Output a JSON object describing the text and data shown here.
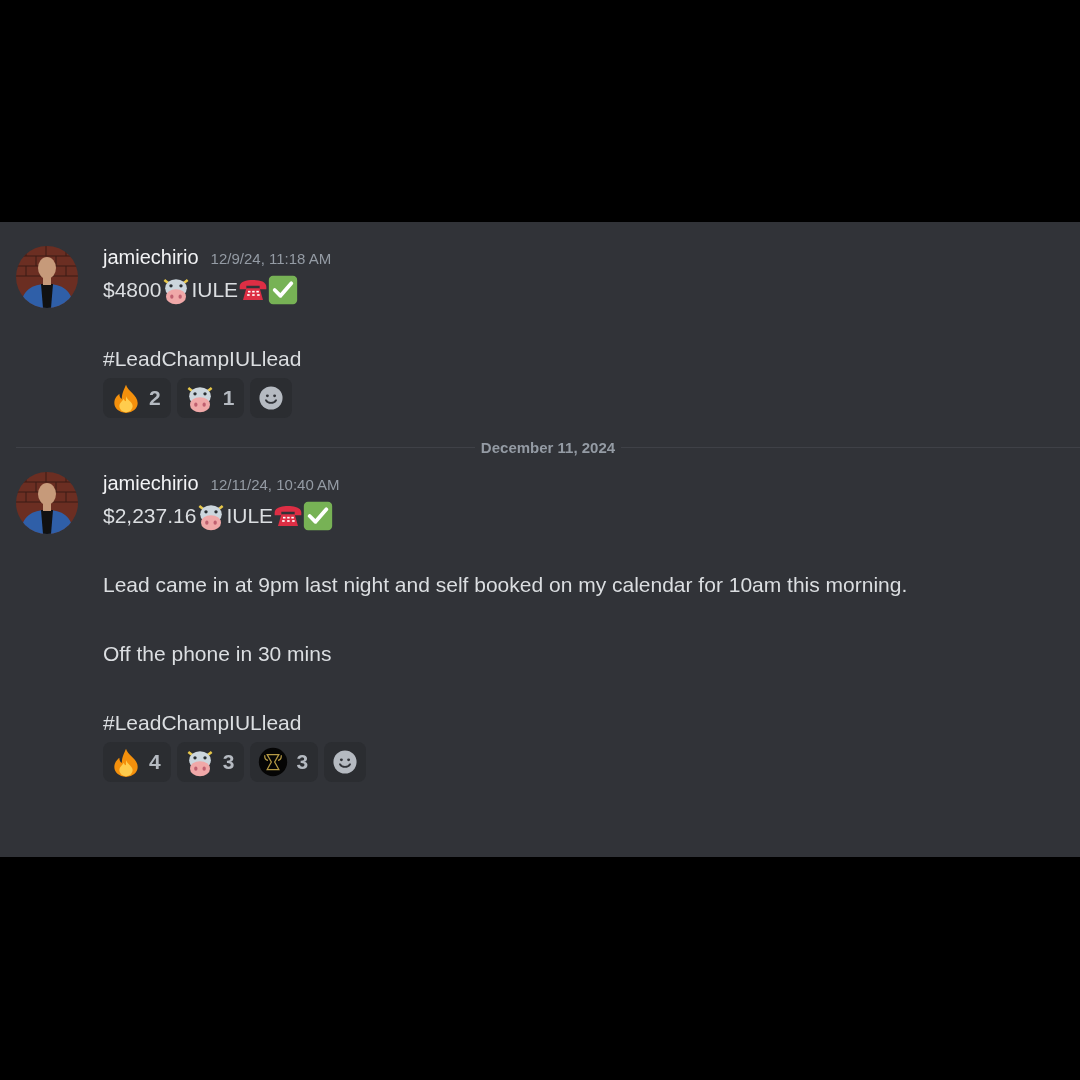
{
  "messages": [
    {
      "username": "jamiechirio",
      "timestamp": "12/9/24, 11:18 AM",
      "avatar": {
        "kind": "picture"
      },
      "lines": [
        [
          {
            "kind": "text",
            "text": "$4800"
          },
          {
            "kind": "cow"
          },
          {
            "kind": "text",
            "text": "IULE"
          },
          {
            "kind": "phone"
          },
          {
            "kind": "check"
          }
        ],
        [
          {
            "kind": "text",
            "text": "#LeadChampIULlead"
          }
        ]
      ],
      "reactions": [
        {
          "kind": "fire",
          "count": "2"
        },
        {
          "kind": "cow",
          "count": "1"
        }
      ]
    },
    {
      "date_divider": "December 11, 2024",
      "username": "jamiechirio",
      "timestamp": "12/11/24, 10:40 AM",
      "avatar": {
        "kind": "picture"
      },
      "lines": [
        [
          {
            "kind": "text",
            "text": "$2,237.16"
          },
          {
            "kind": "cow"
          },
          {
            "kind": "text",
            "text": "IULE"
          },
          {
            "kind": "phone"
          },
          {
            "kind": "check"
          }
        ],
        [
          {
            "kind": "text",
            "text": "Lead came in at 9pm last night and self booked on my calendar for 10am this morning."
          }
        ],
        [
          {
            "kind": "text",
            "text": "Off the phone in 30 mins"
          }
        ],
        [
          {
            "kind": "text",
            "text": "#LeadChampIULlead"
          }
        ]
      ],
      "reactions": [
        {
          "kind": "fire",
          "count": "4"
        },
        {
          "kind": "cow",
          "count": "3"
        },
        {
          "kind": "trophy",
          "count": "3"
        }
      ]
    }
  ]
}
